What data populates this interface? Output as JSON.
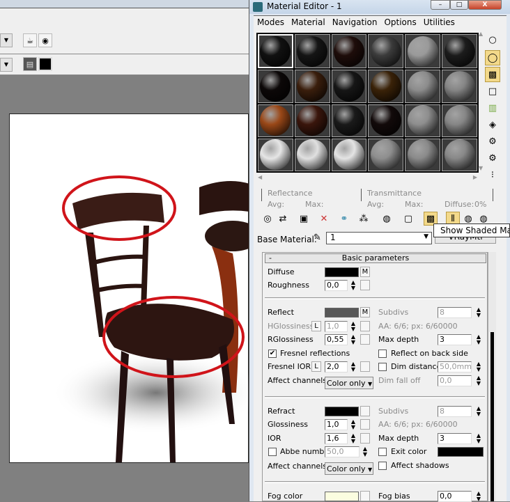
{
  "window": {
    "title": "Material Editor - 1",
    "minimize": "–",
    "maximize": "□",
    "close": "X"
  },
  "menu": [
    "Modes",
    "Material",
    "Navigation",
    "Options",
    "Utilities"
  ],
  "sample_slot_colors": [
    "#111111",
    "#151515",
    "#1e0d0a",
    "#3c3c3c",
    "#9a9a9a",
    "#1c1c1c",
    "#0c0808",
    "#3a1e0c",
    "#161616",
    "#3a2208",
    "#8c8c8c",
    "#858585",
    "#9a4818",
    "#3a160c",
    "#1a1a1a",
    "#120a0a",
    "#8e8e8e",
    "#868686",
    "#e6e6e6",
    "#e0e0e0",
    "#e4e4e4",
    "#8e8e8e",
    "#8a8a8a",
    "#888888"
  ],
  "right_toolbar_icons": [
    "sample-type-icon",
    "backlight-icon",
    "background-checker-icon",
    "sample-uv-tiling-icon",
    "video-color-check-icon",
    "make-preview-icon",
    "options-icon",
    "select-by-material-icon",
    "material-map-navigator-icon"
  ],
  "reflectance": {
    "title": "Reflectance",
    "avg": "Avg:",
    "max": "Max:"
  },
  "transmittance": {
    "title": "Transmittance",
    "avg": "Avg:",
    "max": "Max:",
    "diffuse": "Diffuse:",
    "diffuse_value": "0%"
  },
  "tooltip": "Show Shaded Material in Viewport",
  "base_material": {
    "label": "Base Material:",
    "value": "1",
    "type_button": "VRayMtl"
  },
  "rollout": {
    "collapse": "-",
    "title": "Basic parameters"
  },
  "diffuse": {
    "label": "Diffuse",
    "color": "#000000",
    "map": "M",
    "roughness_label": "Roughness",
    "roughness": "0,0"
  },
  "reflect": {
    "label": "Reflect",
    "color": "#575757",
    "map": "M",
    "subdivs_label": "Subdivs",
    "subdivs": "8",
    "hgloss_label": "HGlossiness",
    "hgloss_lock": "L",
    "hgloss": "1,0",
    "aa": "AA: 6/6; px: 6/60000",
    "rgloss_label": "RGlossiness",
    "rgloss": "0,55",
    "maxdepth_label": "Max depth",
    "maxdepth": "3",
    "fresnel_label": "Fresnel reflections",
    "fresnel_checked": true,
    "backside_label": "Reflect on back side",
    "fresnel_ior_label": "Fresnel IOR",
    "fresnel_ior_lock": "L",
    "fresnel_ior": "2,0",
    "dimdist_label": "Dim distance",
    "dimdist": "50,0mm",
    "affect_label": "Affect channels",
    "affect": "Color only",
    "dimfall_label": "Dim fall off",
    "dimfall": "0,0"
  },
  "refract": {
    "label": "Refract",
    "color": "#000000",
    "subdivs_label": "Subdivs",
    "subdivs": "8",
    "gloss_label": "Glossiness",
    "gloss": "1,0",
    "aa": "AA: 6/6; px: 6/60000",
    "ior_label": "IOR",
    "ior": "1,6",
    "maxdepth_label": "Max depth",
    "maxdepth": "3",
    "abbe_label": "Abbe number",
    "abbe": "50,0",
    "exit_label": "Exit color",
    "exit_color": "#000000",
    "affect_label": "Affect channels",
    "affect": "Color only",
    "shadows_label": "Affect shadows"
  },
  "fog": {
    "label": "Fog color",
    "color": "#fbfde0",
    "bias_label": "Fog bias",
    "bias": "0,0"
  }
}
